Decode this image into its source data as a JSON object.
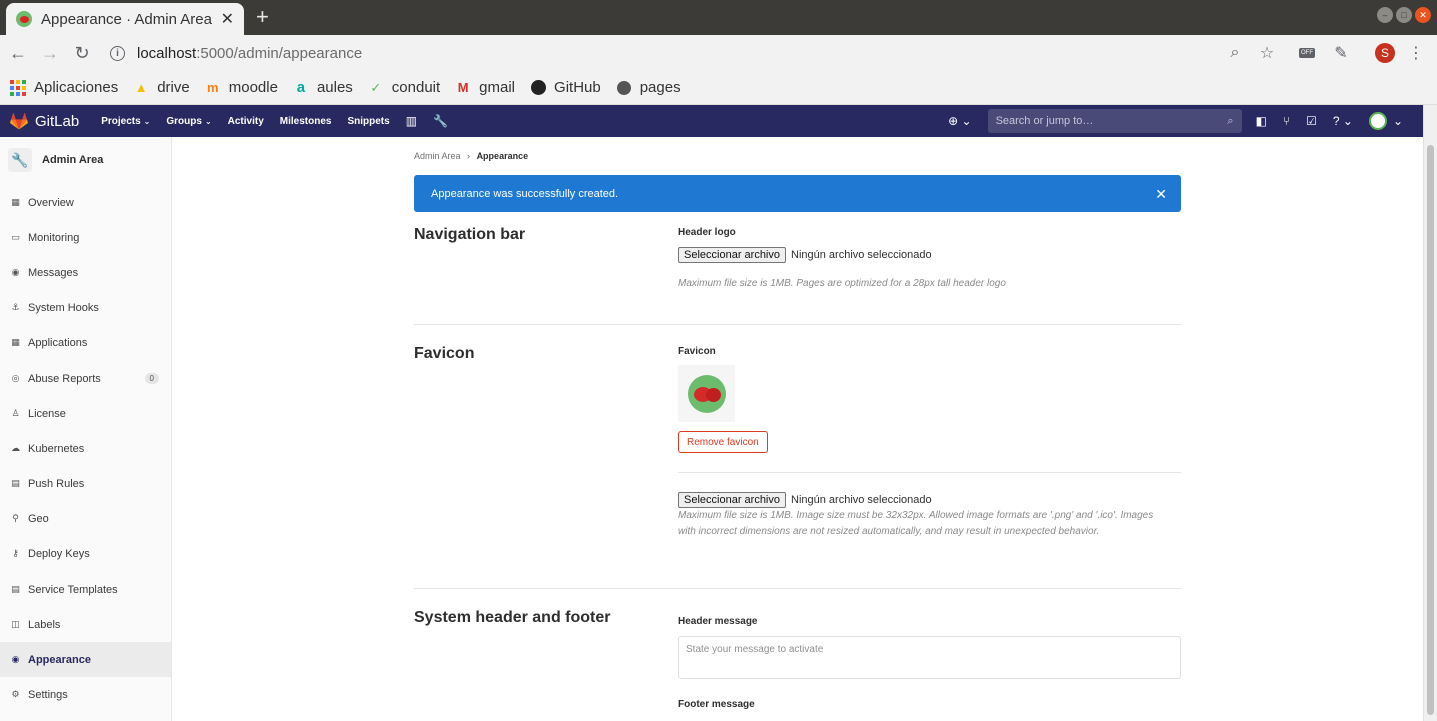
{
  "browser": {
    "tab_title": "Appearance · Admin Area",
    "url_host": "localhost",
    "url_path": ":5000/admin/appearance",
    "profile_initial": "S",
    "bookmarks": [
      {
        "label": "Aplicaciones",
        "icon": "apps-grid-icon"
      },
      {
        "label": "drive",
        "icon": "drive-icon"
      },
      {
        "label": "moodle",
        "icon": "moodle-icon"
      },
      {
        "label": "aules",
        "icon": "aules-icon"
      },
      {
        "label": "conduit",
        "icon": "conduit-icon"
      },
      {
        "label": "gmail",
        "icon": "gmail-icon"
      },
      {
        "label": "GitHub",
        "icon": "github-icon"
      },
      {
        "label": "pages",
        "icon": "globe-icon"
      }
    ]
  },
  "gitlab_nav": {
    "brand": "GitLab",
    "menu": [
      "Projects",
      "Groups",
      "Activity",
      "Milestones",
      "Snippets"
    ],
    "search_placeholder": "Search or jump to…"
  },
  "sidebar": {
    "title": "Admin Area",
    "items": [
      {
        "label": "Overview",
        "icon": "overview-icon"
      },
      {
        "label": "Monitoring",
        "icon": "monitor-icon"
      },
      {
        "label": "Messages",
        "icon": "broadcast-icon"
      },
      {
        "label": "System Hooks",
        "icon": "hook-icon"
      },
      {
        "label": "Applications",
        "icon": "apps-icon"
      },
      {
        "label": "Abuse Reports",
        "icon": "alert-icon",
        "badge": "0"
      },
      {
        "label": "License",
        "icon": "license-icon"
      },
      {
        "label": "Kubernetes",
        "icon": "cloud-icon"
      },
      {
        "label": "Push Rules",
        "icon": "rules-icon"
      },
      {
        "label": "Geo",
        "icon": "location-icon"
      },
      {
        "label": "Deploy Keys",
        "icon": "key-icon"
      },
      {
        "label": "Service Templates",
        "icon": "template-icon"
      },
      {
        "label": "Labels",
        "icon": "label-icon"
      },
      {
        "label": "Appearance",
        "icon": "appearance-icon",
        "active": true
      },
      {
        "label": "Settings",
        "icon": "settings-icon"
      }
    ]
  },
  "breadcrumb": {
    "parent": "Admin Area",
    "current": "Appearance"
  },
  "alert": {
    "message": "Appearance was successfully created."
  },
  "nav_section": {
    "title": "Navigation bar",
    "field_label": "Header logo",
    "file_button": "Seleccionar archivo",
    "file_status": "Ningún archivo seleccionado",
    "help": "Maximum file size is 1MB. Pages are optimized for a 28px tall header logo"
  },
  "favicon_section": {
    "title": "Favicon",
    "field_label": "Favicon",
    "remove_button": "Remove favicon",
    "file_button": "Seleccionar archivo",
    "file_status": "Ningún archivo seleccionado",
    "help": "Maximum file size is 1MB. Image size must be 32x32px. Allowed image formats are '.png' and '.ico'. Images with incorrect dimensions are not resized automatically, and may result in unexpected behavior."
  },
  "system_section": {
    "title": "System header and footer",
    "header_label": "Header message",
    "header_placeholder": "State your message to activate",
    "footer_label": "Footer message"
  },
  "colors": {
    "nav_bg": "#292961",
    "alert_bg": "#1f78d1",
    "danger": "#db3b21"
  }
}
